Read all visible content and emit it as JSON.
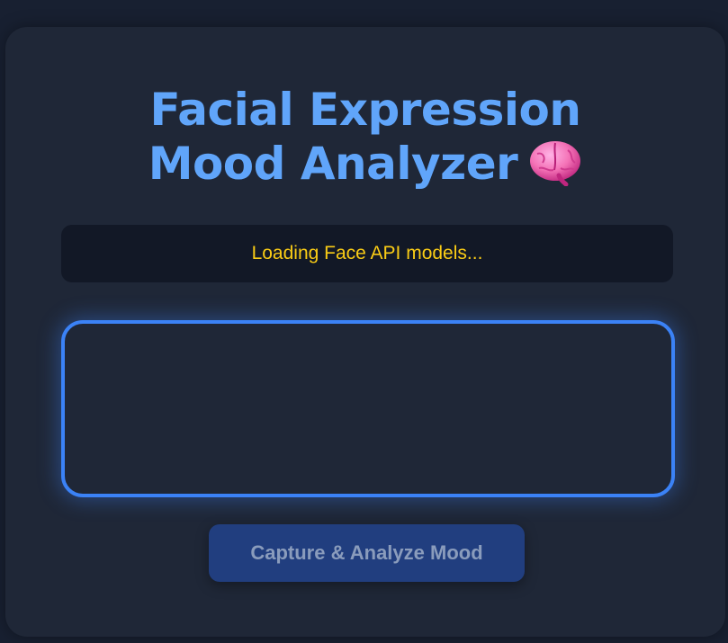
{
  "header": {
    "title_line1": "Facial Expression",
    "title_line2": "Mood Analyzer",
    "title_icon": "brain-icon"
  },
  "status": {
    "message": "Loading Face API models..."
  },
  "video": {
    "label": ""
  },
  "actions": {
    "capture_label": "Capture & Analyze Mood",
    "capture_enabled": false
  },
  "colors": {
    "accent": "#60a5fa",
    "status_text": "#facc15",
    "frame_border": "#3b82f6",
    "button_bg": "#213e7f",
    "card_bg": "#1f2737",
    "page_bg": "#182031"
  }
}
